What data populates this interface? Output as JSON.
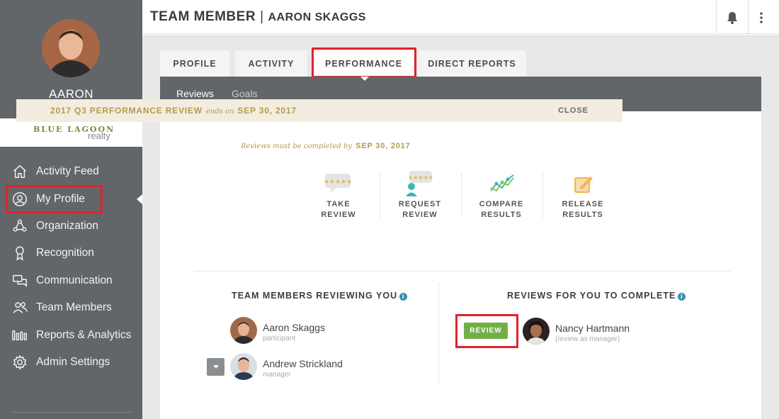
{
  "sidebar": {
    "user_name": "AARON",
    "brand": {
      "line1": "BLUE LAGOON",
      "line2": "realty"
    },
    "items": [
      {
        "label": "Activity Feed",
        "icon": "home-icon"
      },
      {
        "label": "My Profile",
        "icon": "user-circle-icon",
        "active": true
      },
      {
        "label": "Organization",
        "icon": "org-chart-icon"
      },
      {
        "label": "Recognition",
        "icon": "award-ribbon-icon"
      },
      {
        "label": "Communication",
        "icon": "chat-bubbles-icon"
      },
      {
        "label": "Team Members",
        "icon": "people-icon"
      },
      {
        "label": "Reports & Analytics",
        "icon": "bar-chart-icon"
      },
      {
        "label": "Admin Settings",
        "icon": "gear-icon"
      }
    ]
  },
  "header": {
    "title": "TEAM MEMBER",
    "separator": "|",
    "subtitle": "AARON SKAGGS"
  },
  "tabs": [
    {
      "label": "PROFILE"
    },
    {
      "label": "ACTIVITY"
    },
    {
      "label": "PERFORMANCE",
      "active": true
    },
    {
      "label": "DIRECT REPORTS"
    }
  ],
  "subnav": {
    "reviews": "Reviews",
    "goals": "Goals"
  },
  "review_banner": {
    "title": "2017 Q3 PERFORMANCE REVIEW",
    "ends_text": "ends on",
    "end_date": "SEP 30, 2017",
    "close_label": "CLOSE"
  },
  "due_note": {
    "text": "Reviews must be completed by",
    "date": "SEP 30, 2017"
  },
  "steps": [
    {
      "label": "TAKE\nREVIEW",
      "icon": "rating-bubble-icon"
    },
    {
      "label": "REQUEST\nREVIEW",
      "icon": "request-review-icon"
    },
    {
      "label": "COMPARE\nRESULTS",
      "icon": "line-graph-icon"
    },
    {
      "label": "RELEASE\nRESULTS",
      "icon": "edit-square-icon"
    }
  ],
  "reviewing_you": {
    "heading": "TEAM MEMBERS REVIEWING YOU",
    "people": [
      {
        "name": "Aaron Skaggs",
        "role": "participant"
      },
      {
        "name": "Andrew Strickland",
        "role": "manager"
      }
    ]
  },
  "to_complete": {
    "heading": "REVIEWS FOR YOU TO COMPLETE",
    "button_label": "REVIEW",
    "people": [
      {
        "name": "Nancy Hartmann",
        "role": "(review as manager)"
      }
    ]
  },
  "colors": {
    "sidebar_bg": "#626669",
    "highlight_red": "#e2222c",
    "gold": "#b59a4a",
    "green": "#72b045",
    "info_blue": "#3a8fb0"
  }
}
